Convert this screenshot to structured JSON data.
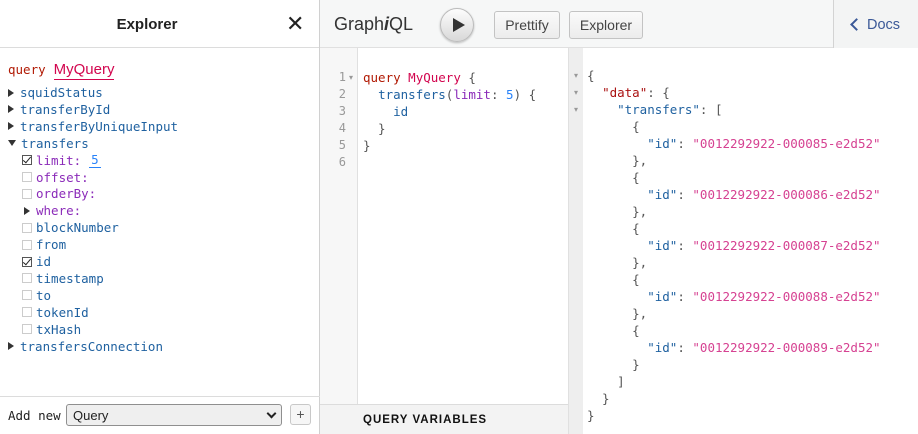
{
  "explorer": {
    "title": "Explorer",
    "close": "✕",
    "operation_keyword": "query",
    "operation_name": "MyQuery",
    "add_new_label": "Add new",
    "add_new_selected": "Query",
    "add_button": "+",
    "tree": [
      {
        "label": "squidStatus",
        "type": "field",
        "control": "caret-right"
      },
      {
        "label": "transferById",
        "type": "field",
        "control": "caret-right"
      },
      {
        "label": "transferByUniqueInput",
        "type": "field",
        "control": "caret-right"
      },
      {
        "label": "transfers",
        "type": "field",
        "control": "caret-down"
      },
      {
        "label": "limit:",
        "type": "arg",
        "control": "checked",
        "value": "5"
      },
      {
        "label": "offset:",
        "type": "arg",
        "control": "unchecked"
      },
      {
        "label": "orderBy:",
        "type": "arg",
        "control": "unchecked"
      },
      {
        "label": "where:",
        "type": "arg",
        "control": "caret-right"
      },
      {
        "label": "blockNumber",
        "type": "field",
        "control": "unchecked"
      },
      {
        "label": "from",
        "type": "field",
        "control": "unchecked"
      },
      {
        "label": "id",
        "type": "field",
        "control": "checked"
      },
      {
        "label": "timestamp",
        "type": "field",
        "control": "unchecked"
      },
      {
        "label": "to",
        "type": "field",
        "control": "unchecked"
      },
      {
        "label": "tokenId",
        "type": "field",
        "control": "unchecked"
      },
      {
        "label": "txHash",
        "type": "field",
        "control": "unchecked"
      },
      {
        "label": "transfersConnection",
        "type": "field",
        "control": "caret-right"
      }
    ]
  },
  "toolbar": {
    "brand_pre": "Graph",
    "brand_i": "i",
    "brand_post": "QL",
    "prettify": "Prettify",
    "explorer": "Explorer",
    "docs": "Docs"
  },
  "editor": {
    "lines": [
      {
        "n": "1",
        "fold": true,
        "tokens": [
          {
            "t": "query",
            "c": "kw"
          },
          {
            "t": " ",
            "c": ""
          },
          {
            "t": "MyQuery",
            "c": "def"
          },
          {
            "t": " {",
            "c": ""
          }
        ]
      },
      {
        "n": "2",
        "fold": false,
        "tokens": [
          {
            "t": "  ",
            "c": ""
          },
          {
            "t": "transfers",
            "c": "field"
          },
          {
            "t": "(",
            "c": ""
          },
          {
            "t": "limit",
            "c": "arg"
          },
          {
            "t": ": ",
            "c": ""
          },
          {
            "t": "5",
            "c": "num"
          },
          {
            "t": ") {",
            "c": ""
          }
        ]
      },
      {
        "n": "3",
        "fold": false,
        "tokens": [
          {
            "t": "    ",
            "c": ""
          },
          {
            "t": "id",
            "c": "field"
          }
        ]
      },
      {
        "n": "4",
        "fold": false,
        "tokens": [
          {
            "t": "  }",
            "c": ""
          }
        ]
      },
      {
        "n": "5",
        "fold": false,
        "tokens": [
          {
            "t": "}",
            "c": ""
          }
        ]
      },
      {
        "n": "6",
        "fold": false,
        "tokens": []
      }
    ],
    "variables_title": "QUERY VARIABLES"
  },
  "result": {
    "lines": [
      {
        "fold": true,
        "tokens": [
          {
            "t": "{",
            "c": ""
          }
        ]
      },
      {
        "fold": true,
        "tokens": [
          {
            "t": "  ",
            "c": ""
          },
          {
            "t": "\"data\"",
            "c": "attr"
          },
          {
            "t": ": {",
            "c": ""
          }
        ]
      },
      {
        "fold": true,
        "tokens": [
          {
            "t": "    ",
            "c": ""
          },
          {
            "t": "\"transfers\"",
            "c": "field"
          },
          {
            "t": ": [",
            "c": ""
          }
        ]
      },
      {
        "fold": false,
        "tokens": [
          {
            "t": "      {",
            "c": ""
          }
        ]
      },
      {
        "fold": false,
        "tokens": [
          {
            "t": "        ",
            "c": ""
          },
          {
            "t": "\"id\"",
            "c": "field"
          },
          {
            "t": ": ",
            "c": ""
          },
          {
            "t": "\"0012292922-000085-e2d52\"",
            "c": "str"
          }
        ]
      },
      {
        "fold": false,
        "tokens": [
          {
            "t": "      },",
            "c": ""
          }
        ]
      },
      {
        "fold": false,
        "tokens": [
          {
            "t": "      {",
            "c": ""
          }
        ]
      },
      {
        "fold": false,
        "tokens": [
          {
            "t": "        ",
            "c": ""
          },
          {
            "t": "\"id\"",
            "c": "field"
          },
          {
            "t": ": ",
            "c": ""
          },
          {
            "t": "\"0012292922-000086-e2d52\"",
            "c": "str"
          }
        ]
      },
      {
        "fold": false,
        "tokens": [
          {
            "t": "      },",
            "c": ""
          }
        ]
      },
      {
        "fold": false,
        "tokens": [
          {
            "t": "      {",
            "c": ""
          }
        ]
      },
      {
        "fold": false,
        "tokens": [
          {
            "t": "        ",
            "c": ""
          },
          {
            "t": "\"id\"",
            "c": "field"
          },
          {
            "t": ": ",
            "c": ""
          },
          {
            "t": "\"0012292922-000087-e2d52\"",
            "c": "str"
          }
        ]
      },
      {
        "fold": false,
        "tokens": [
          {
            "t": "      },",
            "c": ""
          }
        ]
      },
      {
        "fold": false,
        "tokens": [
          {
            "t": "      {",
            "c": ""
          }
        ]
      },
      {
        "fold": false,
        "tokens": [
          {
            "t": "        ",
            "c": ""
          },
          {
            "t": "\"id\"",
            "c": "field"
          },
          {
            "t": ": ",
            "c": ""
          },
          {
            "t": "\"0012292922-000088-e2d52\"",
            "c": "str"
          }
        ]
      },
      {
        "fold": false,
        "tokens": [
          {
            "t": "      },",
            "c": ""
          }
        ]
      },
      {
        "fold": false,
        "tokens": [
          {
            "t": "      {",
            "c": ""
          }
        ]
      },
      {
        "fold": false,
        "tokens": [
          {
            "t": "        ",
            "c": ""
          },
          {
            "t": "\"id\"",
            "c": "field"
          },
          {
            "t": ": ",
            "c": ""
          },
          {
            "t": "\"0012292922-000089-e2d52\"",
            "c": "str"
          }
        ]
      },
      {
        "fold": false,
        "tokens": [
          {
            "t": "      }",
            "c": ""
          }
        ]
      },
      {
        "fold": false,
        "tokens": [
          {
            "t": "    ]",
            "c": ""
          }
        ]
      },
      {
        "fold": false,
        "tokens": [
          {
            "t": "  }",
            "c": ""
          }
        ]
      },
      {
        "fold": false,
        "tokens": [
          {
            "t": "}",
            "c": ""
          }
        ]
      }
    ]
  }
}
